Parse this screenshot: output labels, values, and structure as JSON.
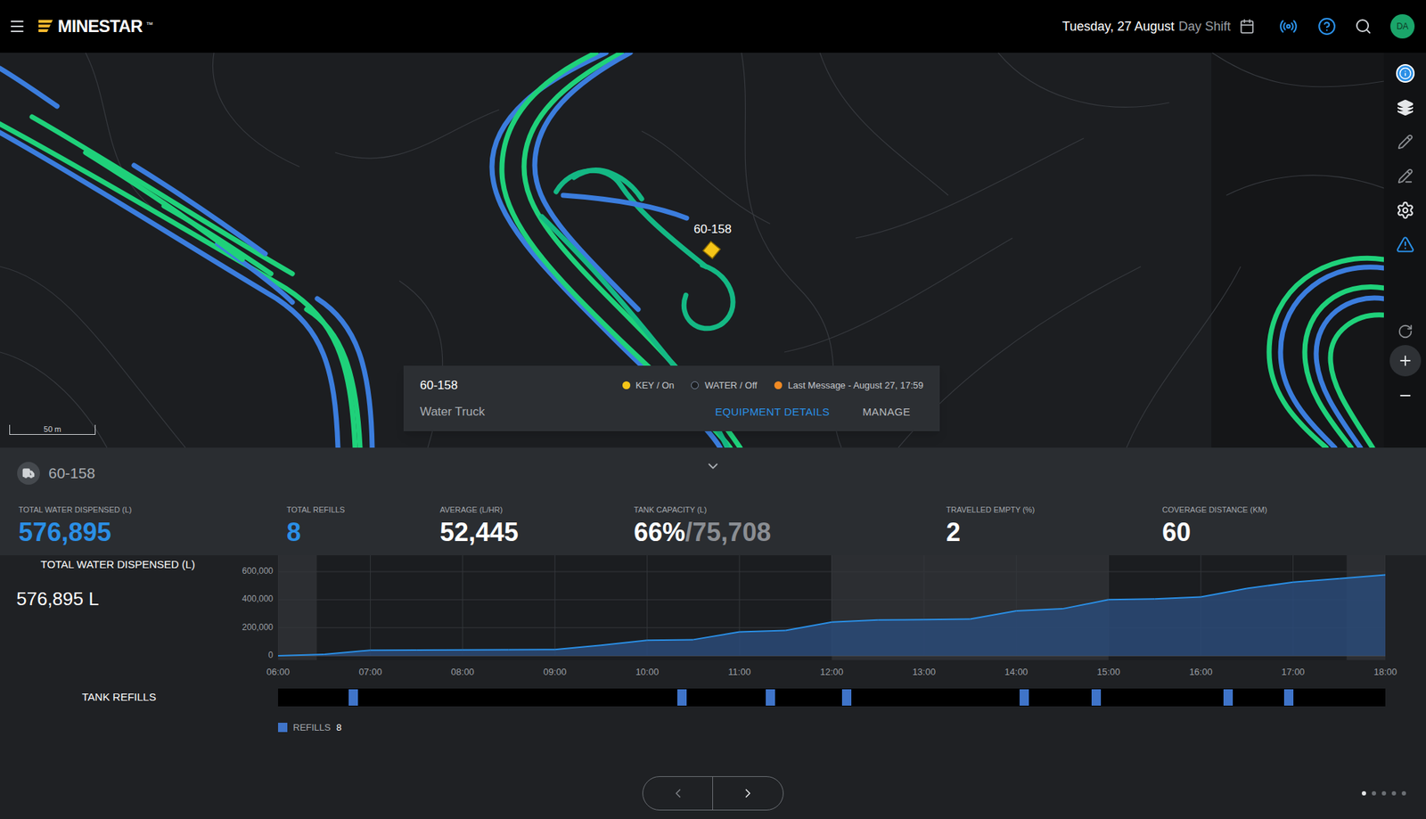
{
  "top_bar": {
    "logo": "MINESTAR",
    "logo_mark": "™",
    "date": "Tuesday, 27 August",
    "shift": "Day Shift",
    "avatar": "DA"
  },
  "map": {
    "equipment_label": "60-158",
    "scale": "50 m"
  },
  "popup": {
    "id": "60-158",
    "type": "Water Truck",
    "statuses": [
      {
        "label": "KEY / On",
        "color": "#f5c518",
        "hollow": false
      },
      {
        "label": "WATER / Off",
        "color": "#1b1d20",
        "hollow": true
      },
      {
        "label": "Last Message - August 27, 17:59",
        "color": "#f08a24",
        "hollow": false
      }
    ],
    "actions": [
      {
        "label": "EQUIPMENT DETAILS",
        "primary": true
      },
      {
        "label": "MANAGE",
        "primary": false
      }
    ]
  },
  "toolbar": [
    {
      "kind": "info",
      "selected": true,
      "disabled": false
    },
    {
      "kind": "layers",
      "selected": false,
      "disabled": false
    },
    {
      "kind": "pencil",
      "selected": false,
      "disabled": true
    },
    {
      "kind": "draw",
      "selected": false,
      "disabled": true
    },
    {
      "kind": "settings",
      "selected": false,
      "disabled": false
    },
    {
      "kind": "warning",
      "selected": false,
      "disabled": false
    },
    {
      "kind": "rotate",
      "selected": false,
      "disabled": true
    },
    {
      "kind": "zoom-in",
      "selected": false,
      "disabled": false
    },
    {
      "kind": "zoom-out",
      "selected": false,
      "disabled": false
    }
  ],
  "panel": {
    "equipment": "60-158",
    "expanded": true
  },
  "stats": [
    {
      "label": "TOTAL WATER DISPENSED (L)",
      "value": "576,895",
      "suffix": "",
      "highlight": true
    },
    {
      "label": "TOTAL REFILLS",
      "value": "8",
      "suffix": "",
      "highlight": true
    },
    {
      "label": "AVERAGE (L/HR)",
      "value": "52,445",
      "suffix": "",
      "highlight": false
    },
    {
      "label": "TANK CAPACITY (L)",
      "value": "66%",
      "suffix": "/75,708",
      "highlight": false
    },
    {
      "label": "TRAVELLED EMPTY (%)",
      "value": "2",
      "suffix": "",
      "highlight": false
    },
    {
      "label": "COVERAGE DISTANCE (KM)",
      "value": "60",
      "suffix": "",
      "highlight": false
    }
  ],
  "chart": {
    "title": "TOTAL WATER DISPENSED (L)",
    "total": "576,895 L",
    "y_ticks": [
      {
        "label": "600,000",
        "value": 600000
      },
      {
        "label": "400,000",
        "value": 400000
      },
      {
        "label": "200,000",
        "value": 200000
      },
      {
        "label": "0",
        "value": 0
      }
    ],
    "x_ticks": [
      "06:00",
      "07:00",
      "08:00",
      "09:00",
      "10:00",
      "11:00",
      "12:00",
      "13:00",
      "14:00",
      "15:00",
      "16:00",
      "17:00",
      "18:00"
    ],
    "start_hour": 6,
    "end_hour": 18,
    "y_max": 600000,
    "bands": [
      {
        "start": 6,
        "end": 6.42
      },
      {
        "start": 12,
        "end": 15
      },
      {
        "start": 17.58,
        "end": 18
      }
    ],
    "series": [
      {
        "name": "Total water dispensed",
        "values": [
          0,
          10000,
          40000,
          41000,
          42000,
          43000,
          45000,
          75000,
          110000,
          115000,
          170000,
          180000,
          240000,
          255000,
          258000,
          262000,
          320000,
          335000,
          400000,
          405000,
          420000,
          480000,
          525000,
          550000,
          576895
        ]
      }
    ]
  },
  "refills": {
    "label": "TANK REFILLS",
    "times": [
      6.81,
      10.37,
      11.33,
      12.16,
      14.08,
      14.86,
      16.29,
      16.95
    ],
    "legend": "REFILLS",
    "count": "8"
  },
  "pages": [
    {
      "selected": true
    },
    {
      "selected": false
    },
    {
      "selected": false
    },
    {
      "selected": false
    },
    {
      "selected": false
    }
  ]
}
